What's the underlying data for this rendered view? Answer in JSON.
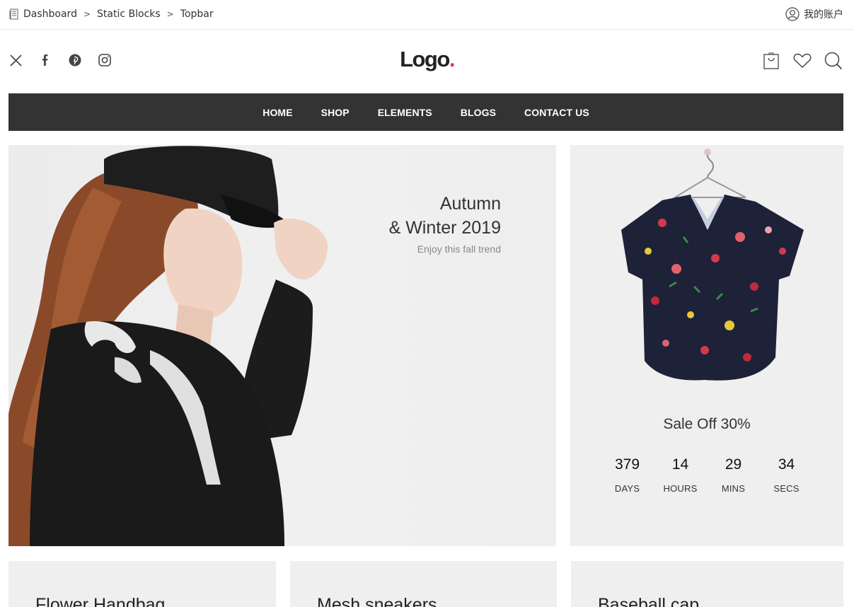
{
  "breadcrumb": {
    "items": [
      "Dashboard",
      "Static Blocks",
      "Topbar"
    ],
    "separator": ">"
  },
  "account": {
    "label": "我的账户",
    "icon": "user-icon"
  },
  "header": {
    "logo_text": "Logo",
    "logo_dot": ".",
    "logo_accent_color": "#e0344f",
    "social_icons": [
      "x-twitter-icon",
      "facebook-icon",
      "pinterest-icon",
      "instagram-icon"
    ],
    "action_icons": [
      "cart-icon",
      "heart-icon",
      "search-icon"
    ]
  },
  "nav": {
    "background": "#333333",
    "items": [
      "HOME",
      "SHOP",
      "ELEMENTS",
      "BLOGS",
      "CONTACT US"
    ]
  },
  "hero": {
    "line1": "Autumn",
    "line2": "& Winter 2019",
    "subtitle": "Enjoy this fall trend"
  },
  "sale": {
    "title": "Sale Off 30%",
    "countdown": [
      {
        "value": "379",
        "label": "DAYS"
      },
      {
        "value": "14",
        "label": "HOURS"
      },
      {
        "value": "29",
        "label": "MINS"
      },
      {
        "value": "34",
        "label": "SECS"
      }
    ]
  },
  "products": [
    {
      "title": "Flower Handbag"
    },
    {
      "title": "Mesh sneakers"
    },
    {
      "title": "Baseball cap"
    }
  ]
}
